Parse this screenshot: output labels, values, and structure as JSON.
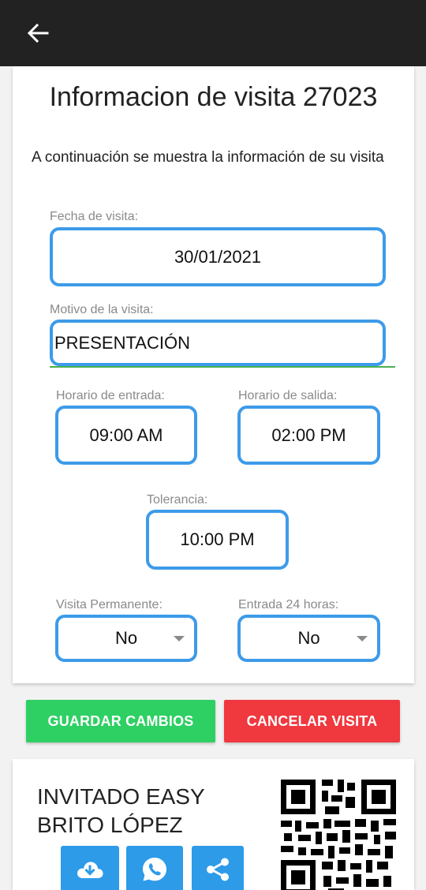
{
  "appbar": {
    "back_icon": "arrow-left-icon",
    "background": "#222222"
  },
  "card": {
    "title": "Informacion de visita 27023",
    "intro": "A continuación se muestra la información de su visita",
    "fecha": {
      "label": "Fecha de visita:",
      "value": "30/01/2021"
    },
    "motivo": {
      "label": "Motivo de la visita:",
      "value": "PRESENTACIÓN"
    },
    "entrada": {
      "label": "Horario de entrada:",
      "value": "09:00 AM"
    },
    "salida": {
      "label": "Horario de salida:",
      "value": "02:00 PM"
    },
    "tolerancia": {
      "label": "Tolerancia:",
      "value": "10:00 PM"
    },
    "permanente": {
      "label": "Visita Permanente:",
      "value": "No"
    },
    "entrada24": {
      "label": "Entrada 24 horas:",
      "value": "No"
    }
  },
  "actions": {
    "save_label": "GUARDAR CAMBIOS",
    "cancel_label": "CANCELAR VISITA",
    "save_color": "#2ed063",
    "cancel_color": "#f0383f"
  },
  "guest": {
    "name_line1": "INVITADO EASY",
    "name_line2": "BRITO LÓPEZ",
    "icons": [
      "cloud-download-icon",
      "whatsapp-icon",
      "share-icon"
    ],
    "accent": "#2d9be8"
  },
  "colors": {
    "field_border": "#3d9be9",
    "focus_underline": "#4caf50"
  }
}
